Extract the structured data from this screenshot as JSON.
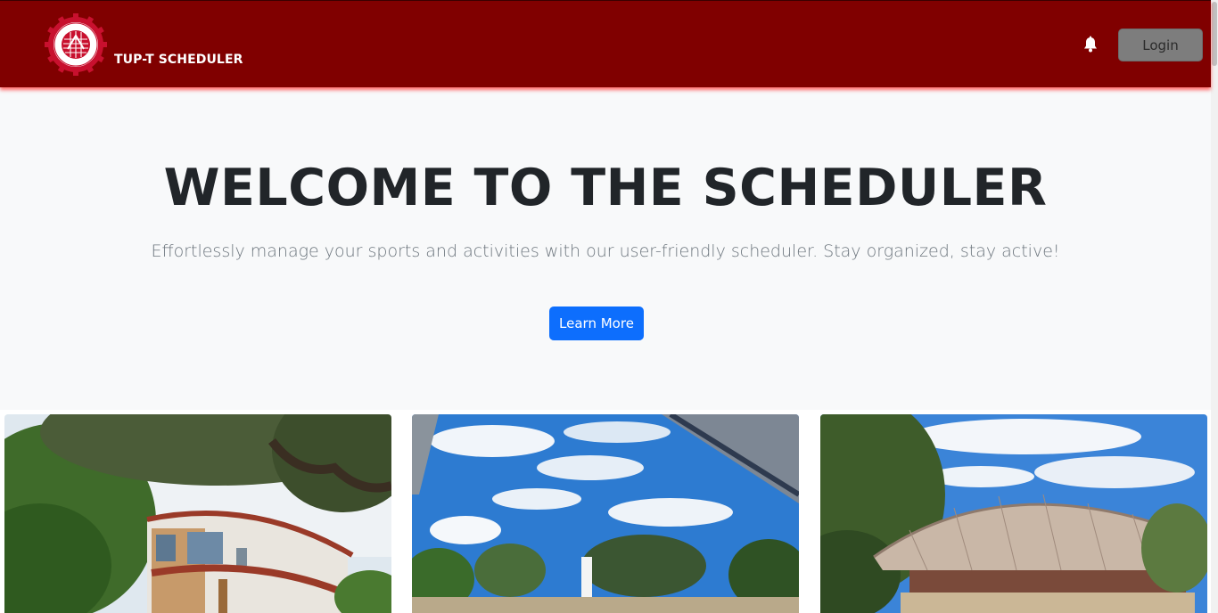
{
  "navbar": {
    "brand": "TUP-T SCHEDULER",
    "logo_icon": "university-seal-logo",
    "bell_icon": "bell-icon",
    "login_label": "Login",
    "background": "#800000"
  },
  "hero": {
    "title": "WELCOME TO THE SCHEDULER",
    "subtitle": "Effortlessly manage your sports and activities with our user-friendly scheduler. Stay organized, stay active!",
    "cta_label": "Learn More",
    "cta_color": "#0d6efd"
  },
  "gallery": {
    "images": [
      "campus-building-photo",
      "campus-plaza-sky-photo",
      "covered-court-photo"
    ]
  }
}
